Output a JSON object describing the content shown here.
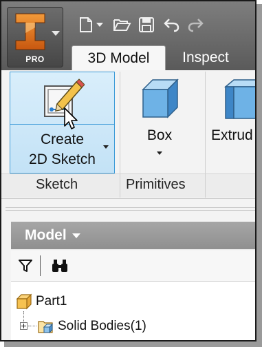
{
  "app": {
    "badge": "PRO",
    "logo_icon": "inventor-i-logo-icon"
  },
  "quick_access": [
    {
      "name": "new-icon"
    },
    {
      "name": "new-dropdown-icon"
    },
    {
      "name": "open-icon"
    },
    {
      "name": "save-icon"
    },
    {
      "name": "undo-icon"
    },
    {
      "name": "redo-icon"
    }
  ],
  "tabs": [
    {
      "label": "3D Model",
      "active": true
    },
    {
      "label": "Inspect",
      "active": false
    }
  ],
  "ribbon": {
    "create_sketch": {
      "line1": "Create",
      "line2": "2D Sketch"
    },
    "box": {
      "label": "Box"
    },
    "extrude": {
      "label": "Extrud"
    },
    "panels": [
      "Sketch",
      "Primitives"
    ]
  },
  "browser": {
    "title": "Model",
    "tree": [
      {
        "label": "Part1",
        "icon": "part-icon"
      },
      {
        "label": "Solid Bodies(1)",
        "icon": "solid-bodies-folder-icon"
      }
    ]
  },
  "colors": {
    "selected_button_bg": "#c8e4f7",
    "selected_button_border": "#3d9bd8",
    "logo_orange": "#e87d1e",
    "topband": "#6a6a6a"
  }
}
